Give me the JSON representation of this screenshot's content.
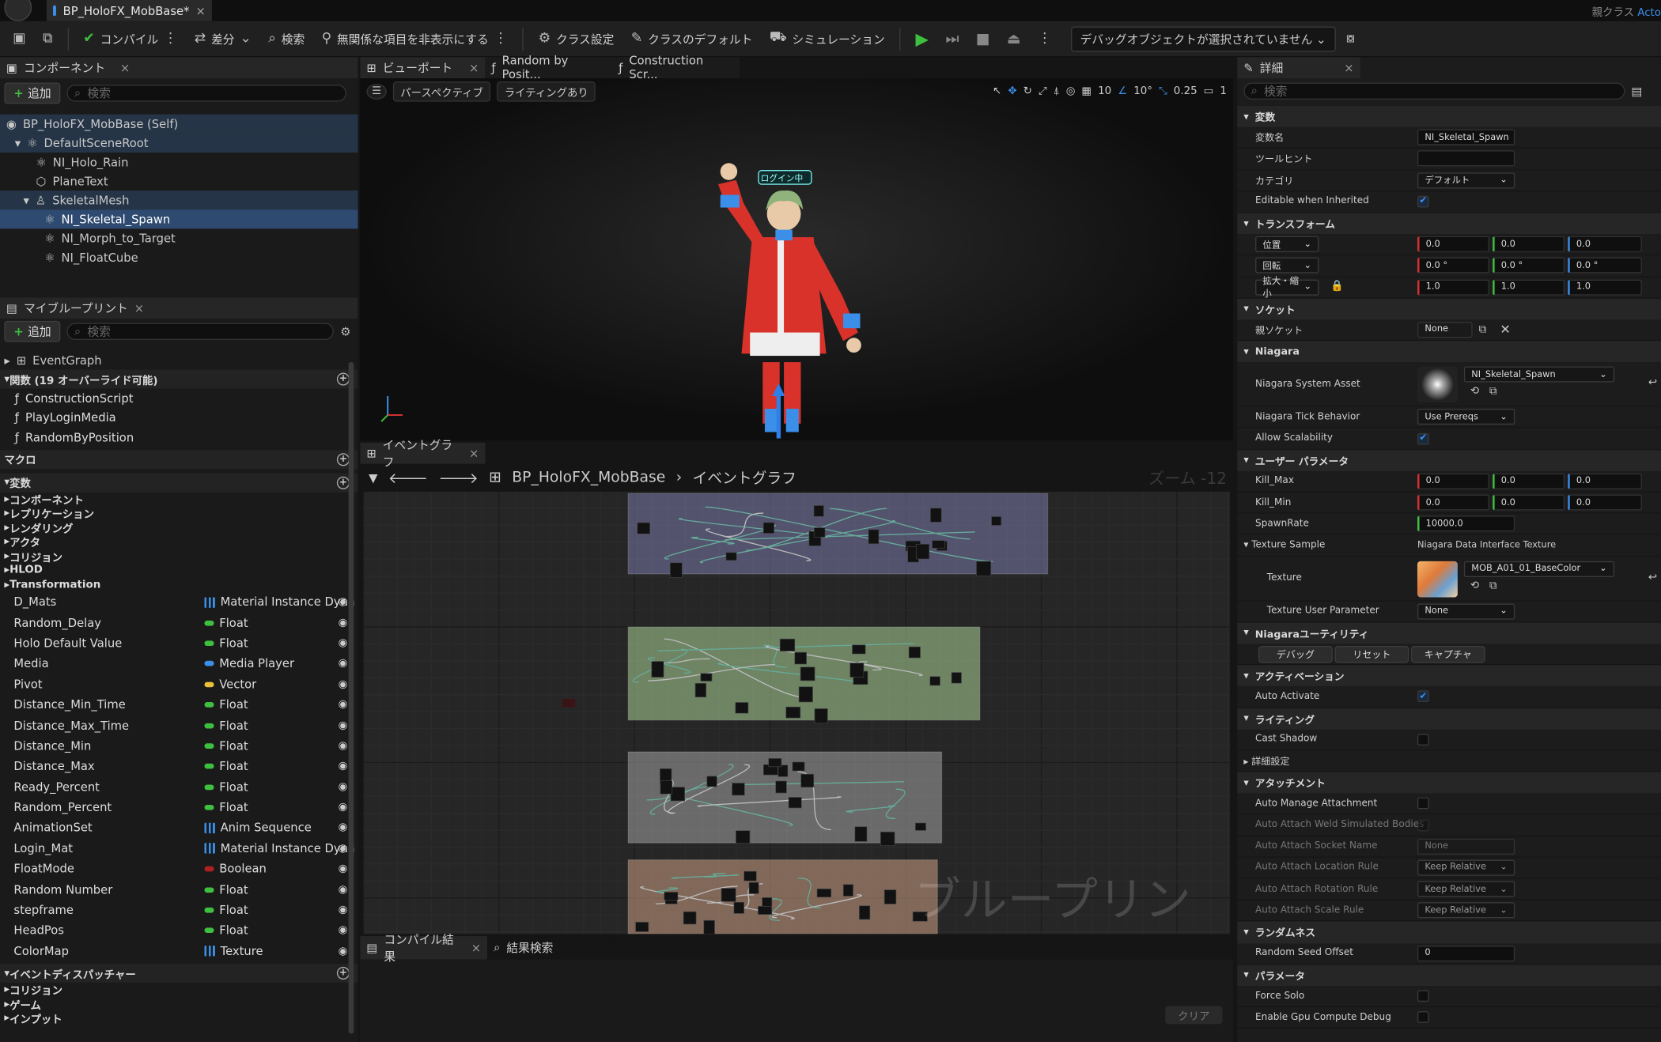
{
  "window": {
    "tab_title": "BP_HoloFX_MobBase*",
    "parent_class_label": "親クラス",
    "parent_class_value": "Acto"
  },
  "toolbar": {
    "compile": "コンパイル",
    "diff": "差分",
    "search": "検索",
    "hide_unrelated": "無関係な項目を非表示にする",
    "class_settings": "クラス設定",
    "class_defaults": "クラスのデフォルト",
    "simulation": "シミュレーション",
    "debug_object": "デバッグオブジェクトが選択されていません"
  },
  "components": {
    "tab": "コンポーネント",
    "add": "追加",
    "search_placeholder": "検索",
    "tree": [
      {
        "label": "BP_HoloFX_MobBase (Self)"
      },
      {
        "label": "DefaultSceneRoot"
      },
      {
        "label": "NI_Holo_Rain"
      },
      {
        "label": "PlaneText"
      },
      {
        "label": "SkeletalMesh"
      },
      {
        "label": "NI_Skeletal_Spawn"
      },
      {
        "label": "NI_Morph_to_Target"
      },
      {
        "label": "NI_FloatCube"
      }
    ]
  },
  "myblueprint": {
    "tab": "マイブループリント",
    "add": "追加",
    "search_placeholder": "検索",
    "event_graph": "EventGraph",
    "functions_header": "関数 (19 オーバーライド可能)",
    "functions": [
      "ConstructionScript",
      "PlayLoginMedia",
      "RandomByPosition"
    ],
    "macros_header": "マクロ",
    "variables_header": "変数",
    "subcats": [
      "コンポーネント",
      "レプリケーション",
      "レンダリング",
      "アクタ",
      "コリジョン",
      "HLOD",
      "Transformation"
    ],
    "variables": [
      {
        "name": "D_Mats",
        "type": "Material Instance Dyna",
        "color": "#3b8fe8"
      },
      {
        "name": "Random_Delay",
        "type": "Float",
        "color": "#3fbf3f"
      },
      {
        "name": "Holo Default Value",
        "type": "Float",
        "color": "#3fbf3f"
      },
      {
        "name": "Media",
        "type": "Media Player",
        "color": "#3b8fe8"
      },
      {
        "name": "Pivot",
        "type": "Vector",
        "color": "#e8c23b"
      },
      {
        "name": "Distance_Min_Time",
        "type": "Float",
        "color": "#3fbf3f"
      },
      {
        "name": "Distance_Max_Time",
        "type": "Float",
        "color": "#3fbf3f"
      },
      {
        "name": "Distance_Min",
        "type": "Float",
        "color": "#3fbf3f"
      },
      {
        "name": "Distance_Max",
        "type": "Float",
        "color": "#3fbf3f"
      },
      {
        "name": "Ready_Percent",
        "type": "Float",
        "color": "#3fbf3f"
      },
      {
        "name": "Random_Percent",
        "type": "Float",
        "color": "#3fbf3f"
      },
      {
        "name": "AnimationSet",
        "type": "Anim Sequence",
        "color": "#3b8fe8"
      },
      {
        "name": "Login_Mat",
        "type": "Material Instance Dyna",
        "color": "#3b8fe8"
      },
      {
        "name": "FloatMode",
        "type": "Boolean",
        "color": "#b02020"
      },
      {
        "name": "Random Number",
        "type": "Float",
        "color": "#3fbf3f"
      },
      {
        "name": "stepframe",
        "type": "Float",
        "color": "#3fbf3f"
      },
      {
        "name": "HeadPos",
        "type": "Float",
        "color": "#3fbf3f"
      },
      {
        "name": "ColorMap",
        "type": "Texture",
        "color": "#3b8fe8"
      }
    ],
    "dispatchers_header": "イベントディスパッチャー",
    "dispatcher_cats": [
      "コリジョン",
      "ゲーム",
      "インプット"
    ]
  },
  "editor_tabs": {
    "viewport": "ビューポート",
    "random": "Random by Posit...",
    "construction": "Construction Scr..."
  },
  "viewport": {
    "perspective": "パースペクティブ",
    "lighting": "ライティングあり",
    "grid": "10",
    "angle": "10°",
    "scale": "0.25",
    "camera": "1",
    "sign_text": "ログイン中"
  },
  "graph": {
    "tab": "イベントグラフ",
    "crumb_root": "BP_HoloFX_MobBase",
    "crumb_child": "イベントグラフ",
    "zoom": "ズーム -12",
    "watermark": "ブループリント"
  },
  "bottom": {
    "compile_results": "コンパイル結果",
    "find_results": "結果検索",
    "clear": "クリア"
  },
  "details": {
    "tab": "詳細",
    "search_placeholder": "検索",
    "variable_section": "変数",
    "var_name_label": "変数名",
    "var_name_value": "NI_Skeletal_Spawn",
    "tooltip_label": "ツールヒント",
    "category_label": "カテゴリ",
    "category_value": "デフォルト",
    "editable_label": "Editable when Inherited",
    "transform_section": "トランスフォーム",
    "location": "位置",
    "rotation": "回転",
    "scale": "拡大・縮小",
    "loc": [
      "0.0",
      "0.0",
      "0.0"
    ],
    "rot": [
      "0.0 °",
      "0.0 °",
      "0.0 °"
    ],
    "scl": [
      "1.0",
      "1.0",
      "1.0"
    ],
    "socket_section": "ソケット",
    "parent_socket_label": "親ソケット",
    "parent_socket_value": "None",
    "niagara_section": "Niagara",
    "system_asset_label": "Niagara System Asset",
    "system_asset_value": "NI_Skeletal_Spawn",
    "tick_label": "Niagara Tick Behavior",
    "tick_value": "Use Prereqs",
    "scalability_label": "Allow Scalability",
    "user_params_section": "ユーザー パラメータ",
    "kill_max_label": "Kill_Max",
    "kill_max": [
      "0.0",
      "0.0",
      "0.0"
    ],
    "kill_min_label": "Kill_Min",
    "kill_min": [
      "0.0",
      "0.0",
      "0.0"
    ],
    "spawn_rate_label": "SpawnRate",
    "spawn_rate_value": "10000.0",
    "texture_sample_label": "Texture Sample",
    "texture_sample_value": "Niagara Data Interface Texture",
    "texture_label": "Texture",
    "texture_value": "MOB_A01_01_BaseColor",
    "texture_user_param_label": "Texture User Parameter",
    "texture_user_param_value": "None",
    "utility_section": "Niagaraユーティリティ",
    "debug_btn": "デバッグ",
    "reset_btn": "リセット",
    "capture_btn": "キャプチャ",
    "activation_section": "アクティベーション",
    "auto_activate_label": "Auto Activate",
    "lighting_section": "ライティング",
    "cast_shadow_label": "Cast Shadow",
    "advanced_label": "詳細設定",
    "attachment_section": "アタッチメント",
    "auto_manage_label": "Auto Manage Attachment",
    "weld_label": "Auto Attach Weld Simulated Bodies",
    "socket_name_label": "Auto Attach Socket Name",
    "socket_name_value": "None",
    "loc_rule_label": "Auto Attach Location Rule",
    "rot_rule_label": "Auto Attach Rotation Rule",
    "scale_rule_label": "Auto Attach Scale Rule",
    "keep_relative": "Keep Relative",
    "random_section": "ランダムネス",
    "seed_label": "Random Seed Offset",
    "seed_value": "0",
    "params_section": "パラメータ",
    "force_solo_label": "Force Solo",
    "gpu_debug_label": "Enable Gpu Compute Debug"
  }
}
